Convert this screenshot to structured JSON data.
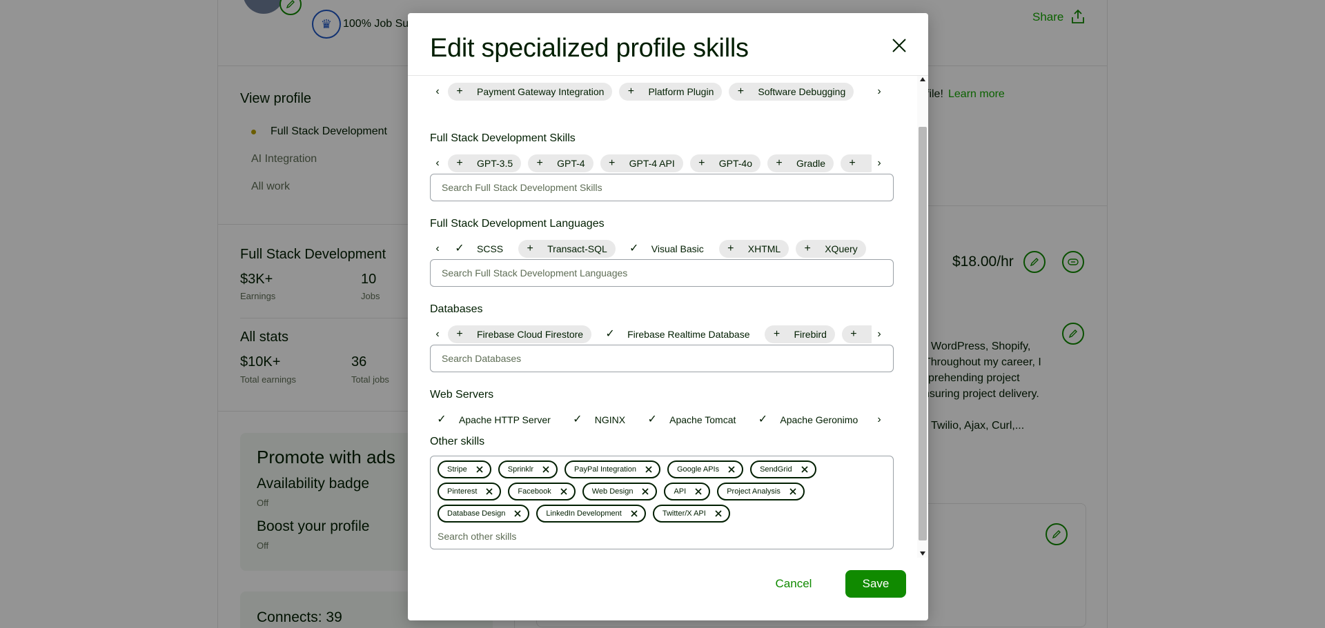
{
  "background": {
    "job_success": "100% Job Su",
    "share_label": "Share",
    "view_profile": "View profile",
    "profile_tabs": [
      "Full Stack Development",
      "AI Integration",
      "All work"
    ],
    "specialized_title": "Full Stack Development",
    "earnings_value": "$3K+",
    "earnings_label": "Earnings",
    "jobs_value": "10",
    "jobs_label": "Jobs",
    "all_stats": "All stats",
    "total_earnings_value": "$10K+",
    "total_earnings_label": "Total earnings",
    "total_jobs_value": "36",
    "total_jobs_label": "Total jobs",
    "promote_title": "Promote with ads",
    "availability_badge": "Availability badge",
    "availability_state": "Off",
    "boost_profile": "Boost your profile",
    "boost_state": "Off",
    "connects": "Connects: 39",
    "learn_more_prefix": "file!",
    "learn_more": "Learn more",
    "rate": "$18.00/hr",
    "overview_line1": "WordPress, Shopify,",
    "overview_line2": "Throughout my career, I",
    "overview_line3": "prehending project",
    "overview_line4": "nsuring project delivery.",
    "overview_line5": "Twilio, Ajax, Curl,..."
  },
  "modal": {
    "title": "Edit specialized profile skills",
    "sections": [
      {
        "label": "",
        "chips": [
          {
            "text": "Payment Gateway Integration",
            "selected": false
          },
          {
            "text": "Platform Plugin",
            "selected": false
          },
          {
            "text": "Software Debugging",
            "selected": false
          }
        ]
      },
      {
        "label": "Full Stack Development Skills",
        "search_placeholder": "Search Full Stack Development Skills",
        "chips": [
          {
            "text": "GPT-3.5",
            "selected": false
          },
          {
            "text": "GPT-4",
            "selected": false
          },
          {
            "text": "GPT-4 API",
            "selected": false
          },
          {
            "text": "GPT-4o",
            "selected": false
          },
          {
            "text": "Gradle",
            "selected": false
          },
          {
            "text": "",
            "selected": false
          }
        ]
      },
      {
        "label": "Full Stack Development Languages",
        "search_placeholder": "Search Full Stack Development Languages",
        "chips": [
          {
            "text": "SCSS",
            "selected": true
          },
          {
            "text": "Transact-SQL",
            "selected": false
          },
          {
            "text": "Visual Basic",
            "selected": true
          },
          {
            "text": "XHTML",
            "selected": false
          },
          {
            "text": "XQuery",
            "selected": false
          }
        ]
      },
      {
        "label": "Databases",
        "search_placeholder": "Search Databases",
        "chips": [
          {
            "text": "Firebase Cloud Firestore",
            "selected": false
          },
          {
            "text": "Firebase Realtime Database",
            "selected": true
          },
          {
            "text": "Firebird",
            "selected": false
          },
          {
            "text": "",
            "selected": false
          }
        ]
      },
      {
        "label": "Web Servers",
        "chips": [
          {
            "text": "Apache HTTP Server",
            "selected": true
          },
          {
            "text": "NGINX",
            "selected": true
          },
          {
            "text": "Apache Tomcat",
            "selected": true
          },
          {
            "text": "Apache Geronimo",
            "selected": true
          }
        ]
      }
    ],
    "other_skills_label": "Other skills",
    "other_skills": [
      "Stripe",
      "Sprinklr",
      "PayPal Integration",
      "Google APIs",
      "SendGrid",
      "Pinterest",
      "Facebook",
      "Web Design",
      "API",
      "Project Analysis",
      "Database Design",
      "LinkedIn Development",
      "Twitter/X API"
    ],
    "other_skills_placeholder": "Search other skills",
    "cancel_label": "Cancel",
    "save_label": "Save"
  },
  "colors": {
    "accent": "#108a00",
    "overlay": "rgba(0,0,0,0.42)",
    "chip_bg": "#e9e9e9"
  }
}
